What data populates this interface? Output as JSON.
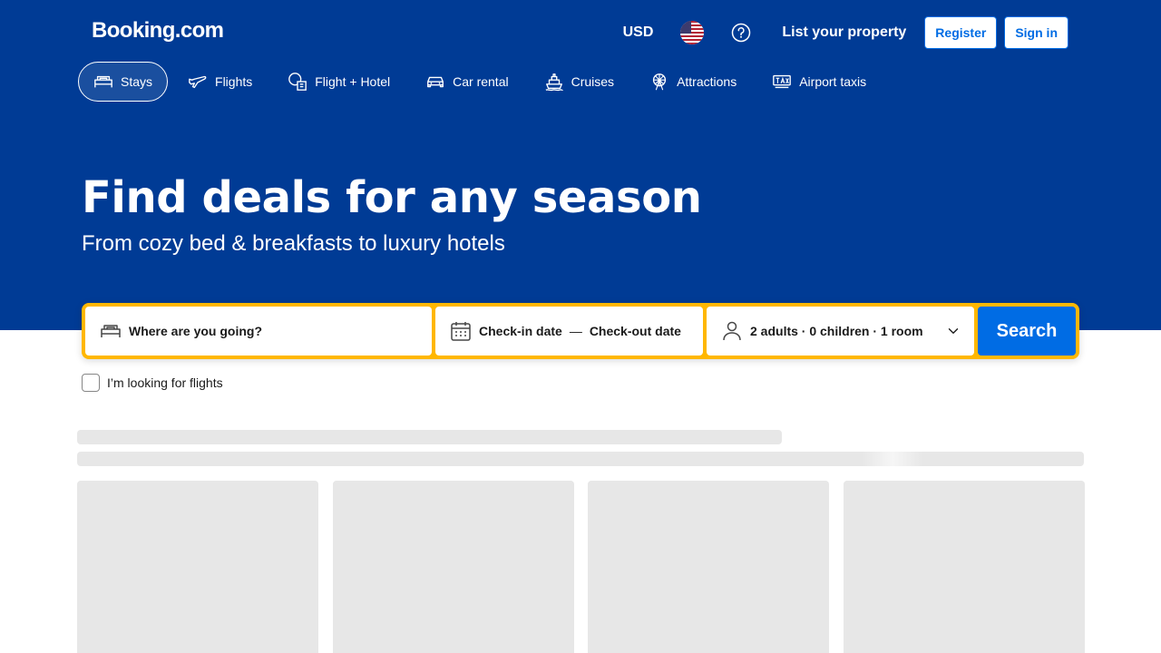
{
  "header": {
    "logo": "Booking.com",
    "currency": "USD",
    "list_property": "List your property",
    "register": "Register",
    "sign_in": "Sign in"
  },
  "nav": {
    "items": [
      {
        "label": "Stays",
        "icon": "bed-icon",
        "active": true
      },
      {
        "label": "Flights",
        "icon": "plane-icon"
      },
      {
        "label": "Flight + Hotel",
        "icon": "flight-hotel-icon"
      },
      {
        "label": "Car rental",
        "icon": "car-icon"
      },
      {
        "label": "Cruises",
        "icon": "ship-icon"
      },
      {
        "label": "Attractions",
        "icon": "ferris-wheel-icon"
      },
      {
        "label": "Airport taxis",
        "icon": "taxi-icon"
      }
    ]
  },
  "hero": {
    "title": "Find deals for any season",
    "subtitle": "From cozy bed & breakfasts to luxury hotels"
  },
  "search": {
    "destination_placeholder": "Where are you going?",
    "checkin": "Check-in date",
    "dash": "—",
    "checkout": "Check-out date",
    "occupancy": "2 adults · 0 children · 1 room",
    "button": "Search"
  },
  "flights_option": {
    "label": "I’m looking for flights",
    "checked": false
  },
  "colors": {
    "brand_blue": "#003b95",
    "search_border": "#ffb700",
    "action_blue": "#006ce4"
  }
}
